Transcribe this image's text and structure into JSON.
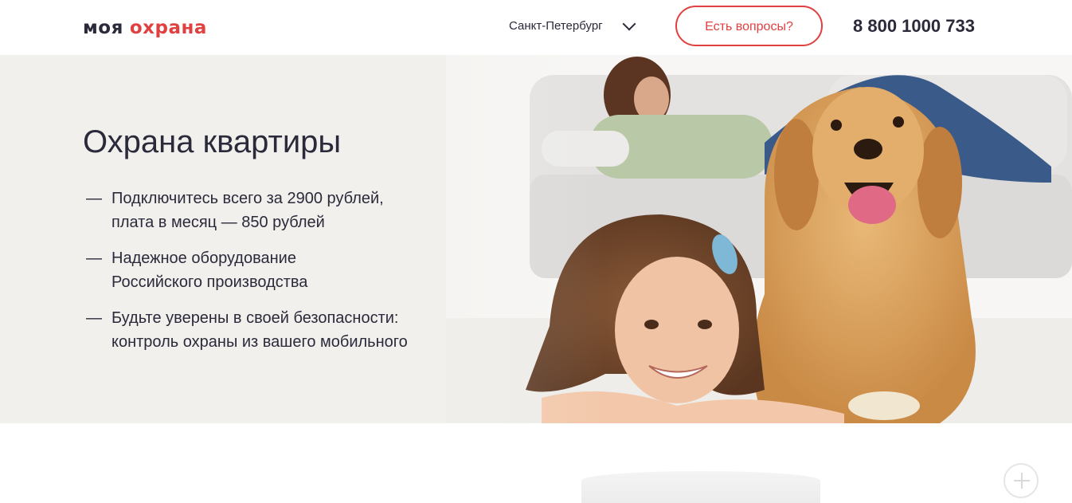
{
  "header": {
    "logo_part1": "моя",
    "logo_part2": "охрана",
    "city": "Санкт-Петербург",
    "ask_button": "Есть вопросы?",
    "phone": "8 800 1000 733"
  },
  "hero": {
    "title": "Охрана квартиры",
    "features": [
      {
        "dash": "—",
        "line1": "Подключитесь всего за 2900 рублей,",
        "line2": "плата в месяц — 850 рублей"
      },
      {
        "dash": "—",
        "line1": "Надежное оборудование",
        "line2": "Российского производства"
      },
      {
        "dash": "—",
        "line1": "Будьте уверены в своей безопасности:",
        "line2": "контроль охраны из вашего мобильного"
      }
    ],
    "image_subject": "girl-dog-sofa-photo"
  },
  "icons": {
    "city_dropdown": "chevron-down-icon",
    "expand": "plus-icon"
  },
  "colors": {
    "accent": "#e0403f",
    "text": "#2b2a3a",
    "hero_bg": "#f2f0ed"
  }
}
